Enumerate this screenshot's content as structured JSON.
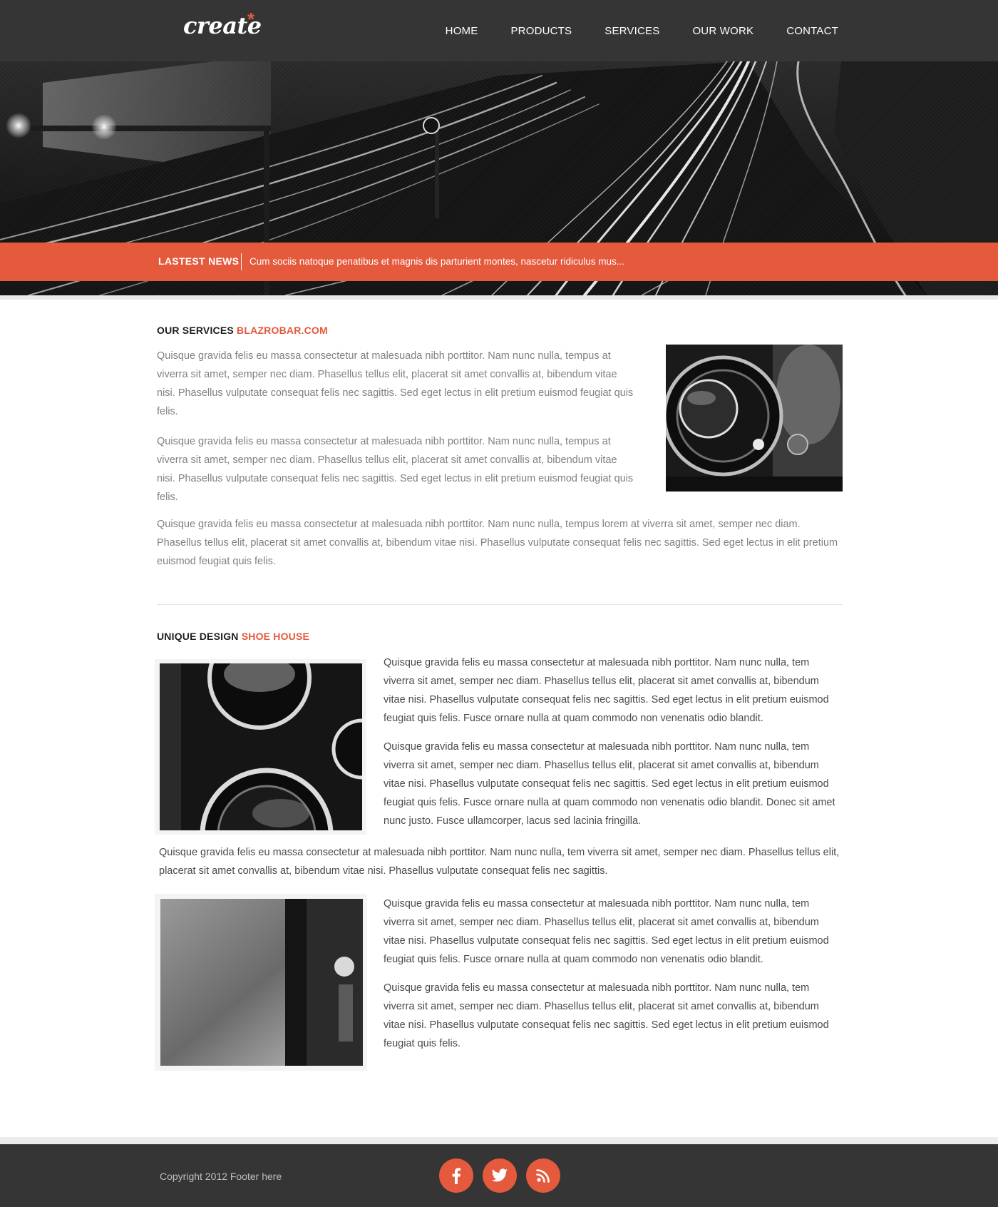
{
  "header": {
    "logo": "create",
    "nav": [
      "HOME",
      "PRODUCTS",
      "SERVICES",
      "OUR WORK",
      "CONTACT"
    ]
  },
  "news": {
    "label": "LASTEST NEWS",
    "text": "Cum sociis natoque penatibus et magnis dis parturient montes, nascetur ridiculus mus..."
  },
  "services": {
    "title": "OUR SERVICES",
    "accent": "BLAZROBAR.COM",
    "p1": "Quisque gravida felis eu massa consectetur at malesuada nibh porttitor. Nam nunc nulla, tempus at viverra sit amet, semper nec diam. Phasellus tellus elit, placerat sit amet convallis at, bibendum vitae nisi. Phasellus vulputate consequat felis nec sagittis. Sed eget lectus in elit pretium euismod feugiat quis felis.",
    "p2": "Quisque gravida felis eu massa consectetur at malesuada nibh porttitor. Nam nunc nulla, tempus at viverra sit amet, semper nec diam. Phasellus tellus elit, placerat sit amet convallis at, bibendum vitae nisi. Phasellus vulputate consequat felis nec sagittis. Sed eget lectus in elit pretium euismod feugiat quis felis.",
    "p3": "Quisque gravida felis eu massa consectetur at malesuada nibh porttitor. Nam nunc nulla, tempus lorem at  viverra sit amet, semper nec diam. Phasellus tellus elit, placerat sit amet convallis at, bibendum vitae nisi. Phasellus vulputate consequat felis nec sagittis. Sed eget lectus in elit pretium euismod feugiat quis felis."
  },
  "design": {
    "title": "UNIQUE DESIGN",
    "accent": "SHOE HOUSE",
    "p1": "Quisque gravida felis eu massa consectetur at malesuada nibh porttitor. Nam nunc nulla, tem viverra sit amet, semper nec diam. Phasellus tellus elit, placerat sit amet convallis at, bibendum vitae nisi.  Phasellus vulputate consequat felis nec sagittis. Sed eget lectus in elit pretium euismod feugiat quis felis. Fusce ornare nulla at quam commodo non venenatis odio blandit.",
    "p2": "Quisque gravida felis eu massa consectetur at malesuada nibh porttitor. Nam nunc nulla, tem viverra sit amet, semper nec diam. Phasellus tellus elit, placerat sit amet convallis at, bibendum vitae nisi. Phasellus vulputate consequat felis nec sagittis. Sed eget lectus in elit pretium euismod feugiat quis felis. Fusce ornare nulla at quam commodo non venenatis odio blandit. Donec sit amet nunc justo. Fusce ullamcorper, lacus sed lacinia fringilla.",
    "p3": "Quisque gravida felis eu massa consectetur at malesuada nibh porttitor. Nam nunc nulla, tem viverra sit amet, semper nec diam. Phasellus tellus elit, placerat sit amet convallis at, bibendum vitae nisi. Phasellus vulputate consequat felis nec sagittis.",
    "p4": "Quisque gravida felis eu massa consectetur at malesuada nibh porttitor. Nam nunc nulla, tem viverra sit amet, semper nec diam. Phasellus tellus elit, placerat sit amet convallis at, bibendum vitae nisi.  Phasellus vulputate consequat felis nec sagittis. Sed eget lectus in elit pretium euismod feugiat quis felis. Fusce ornare nulla at quam commodo non venenatis odio blandit.",
    "p5": "Quisque gravida felis eu massa consectetur at malesuada nibh porttitor. Nam nunc nulla, tem viverra sit amet, semper nec diam. Phasellus tellus elit, placerat sit amet convallis at, bibendum vitae nisi. Phasellus vulputate consequat felis nec sagittis. Sed eget lectus in elit pretium euismod feugiat quis felis."
  },
  "footer": {
    "copyright": "Copyright 2012 Footer here",
    "social": [
      "facebook-icon",
      "twitter-icon",
      "rss-icon"
    ]
  },
  "colors": {
    "accent": "#e5593c",
    "header_bg": "#353535",
    "text_muted": "#808080",
    "text_dark": "#4a4a4a"
  }
}
